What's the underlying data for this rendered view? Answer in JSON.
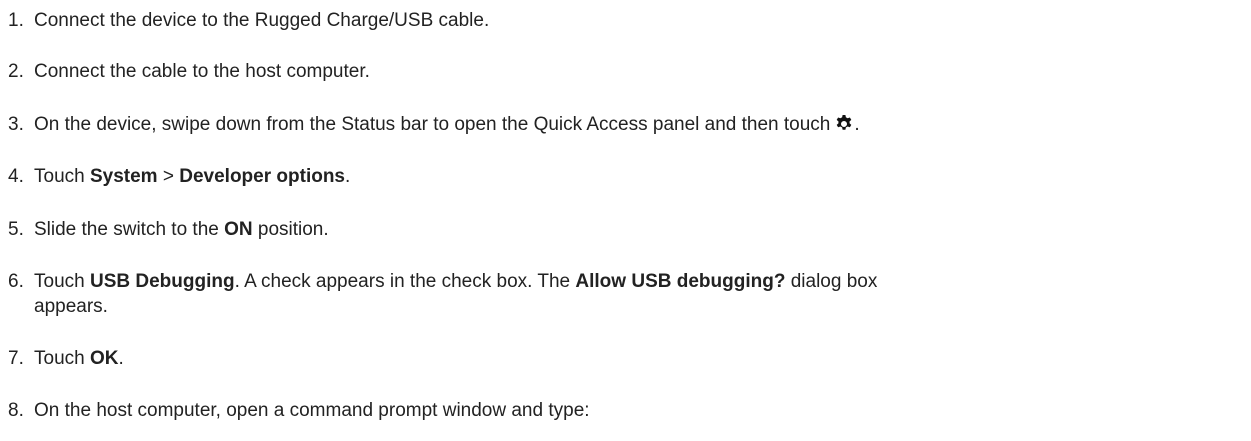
{
  "steps": [
    {
      "num": "1.",
      "parts": [
        "Connect the device to the Rugged Charge/USB cable."
      ]
    },
    {
      "num": "2.",
      "parts": [
        "Connect the cable to the host computer."
      ]
    },
    {
      "num": "3.",
      "parts": [
        "On the device, swipe down from the Status bar to open the Quick Access panel and then touch",
        "."
      ]
    },
    {
      "num": "4.",
      "parts": [
        "Touch ",
        "System",
        " > ",
        "Developer options",
        "."
      ]
    },
    {
      "num": "5.",
      "parts": [
        "Slide the switch to the ",
        "ON",
        " position."
      ]
    },
    {
      "num": "6.",
      "parts": [
        "Touch ",
        "USB Debugging",
        ". A check appears in the check box. The ",
        "Allow USB debugging?",
        " dialog box"
      ],
      "continuation": "appears."
    },
    {
      "num": "7.",
      "parts": [
        "Touch ",
        "OK",
        "."
      ]
    },
    {
      "num": "8.",
      "parts": [
        "On the host computer, open a command prompt window and type:"
      ]
    }
  ],
  "icons": {
    "settings": "gear-icon"
  }
}
